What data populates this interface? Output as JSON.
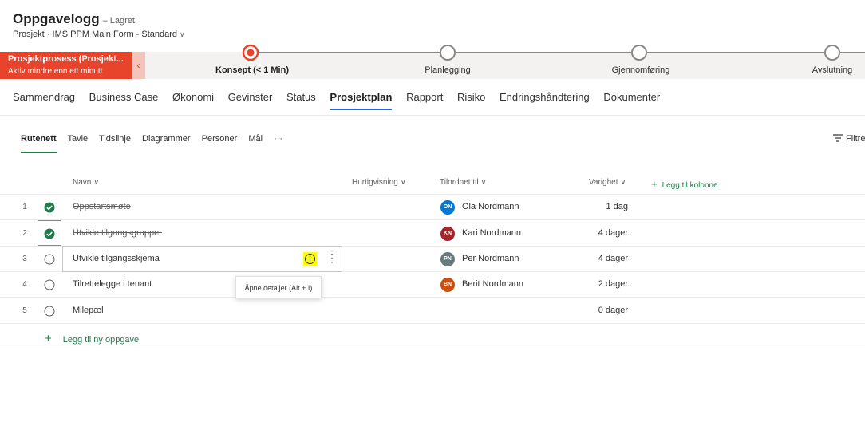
{
  "header": {
    "title": "Oppgavelogg",
    "saved_status": "– Lagret",
    "entity": "Prosjekt",
    "separator": "·",
    "form_name": "IMS PPM Main Form - Standard"
  },
  "process": {
    "name": "Prosjektprosess (Prosjekt...",
    "active_since": "Aktiv mindre enn ett minutt",
    "back_glyph": "‹",
    "stages": [
      {
        "label": "Konsept  (< 1 Min)",
        "active": true
      },
      {
        "label": "Planlegging",
        "active": false
      },
      {
        "label": "Gjennomføring",
        "active": false
      },
      {
        "label": "Avslutning",
        "active": false
      }
    ]
  },
  "tabs": [
    "Sammendrag",
    "Business Case",
    "Økonomi",
    "Gevinster",
    "Status",
    "Prosjektplan",
    "Rapport",
    "Risiko",
    "Endringshåndtering",
    "Dokumenter"
  ],
  "selected_tab": "Prosjektplan",
  "subtabs": [
    "Rutenett",
    "Tavle",
    "Tidslinje",
    "Diagrammer",
    "Personer",
    "Mål",
    "···"
  ],
  "selected_subtab": "Rutenett",
  "filter_label": "Filtre",
  "columns": {
    "name": "Navn",
    "quickview": "Hurtigvisning",
    "assigned": "Tilordnet til",
    "duration": "Varighet",
    "add_column": "Legg til kolonne"
  },
  "tasks": [
    {
      "num": "1",
      "name": "Oppstartsmøte",
      "done": true,
      "initials": "ON",
      "person": "Ola Nordmann",
      "avatar_color": "#0078d4",
      "duration": "1 dag"
    },
    {
      "num": "2",
      "name": "Utvikle tilgangsgrupper",
      "done": true,
      "initials": "KN",
      "person": "Kari Nordmann",
      "avatar_color": "#a4262c",
      "duration": "4 dager"
    },
    {
      "num": "3",
      "name": "Utvikle tilgangsskjema",
      "done": false,
      "initials": "PN",
      "person": "Per Nordmann",
      "avatar_color": "#69797e",
      "duration": "4 dager"
    },
    {
      "num": "4",
      "name": "Tilrettelegge i tenant",
      "done": false,
      "initials": "BN",
      "person": "Berit Nordmann",
      "avatar_color": "#ca5010",
      "duration": "2 dager"
    },
    {
      "num": "5",
      "name": "Milepæl",
      "done": false,
      "initials": "",
      "person": "",
      "avatar_color": "",
      "duration": "0 dager"
    }
  ],
  "tooltip": "Åpne detaljer (Alt + I)",
  "add_task": "Legg til ny oppgave",
  "colors": {
    "accent_green": "#237b4b",
    "stage_active_red": "#e8432b",
    "tab_underline": "#2266e3",
    "info_highlight": "#ffff00"
  }
}
